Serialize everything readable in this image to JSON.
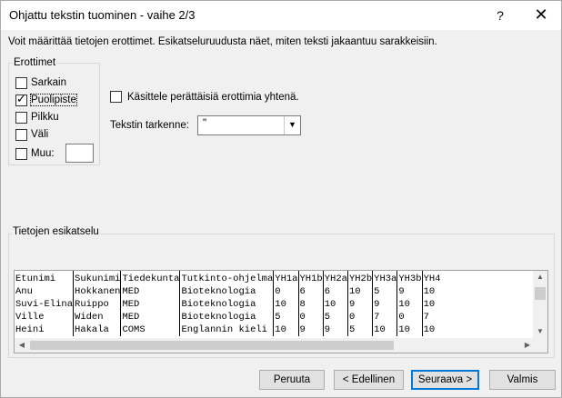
{
  "window": {
    "title": "Ohjattu tekstin tuominen - vaihe 2/3",
    "help": "?",
    "close": "✕"
  },
  "intro": "Voit määrittää tietojen erottimet. Esikatseluruudusta näet, miten teksti jakaantuu sarakkeisiin.",
  "delimiters": {
    "legend": "Erottimet",
    "items": [
      {
        "label": "Sarkain",
        "checked": false
      },
      {
        "label": "Puolipiste",
        "checked": true
      },
      {
        "label": "Pilkku",
        "checked": false
      },
      {
        "label": "Väli",
        "checked": false
      },
      {
        "label": "Muu:",
        "checked": false
      }
    ],
    "other_value": ""
  },
  "consecutive": {
    "label": "Käsittele perättäisiä erottimia yhtenä.",
    "checked": false
  },
  "text_qualifier": {
    "label": "Tekstin tarkenne:",
    "value": "\""
  },
  "preview": {
    "legend": "Tietojen esikatselu",
    "header": [
      "Etunimi",
      "Sukunimi",
      "Tiedekunta",
      "Tutkinto-ohjelma",
      "YH1a",
      "YH1b",
      "YH2a",
      "YH2b",
      "YH3a",
      "YH3b",
      "YH4"
    ],
    "rows": [
      [
        "Anu",
        "Hokkanen",
        "MED",
        "Bioteknologia",
        "0",
        "6",
        "6",
        "10",
        "5",
        "9",
        "10"
      ],
      [
        "Suvi-Elina",
        "Ruippo",
        "MED",
        "Bioteknologia",
        "10",
        "8",
        "10",
        "9",
        "9",
        "10",
        "10"
      ],
      [
        "Ville",
        "Widen",
        "MED",
        "Bioteknologia",
        "5",
        "0",
        "5",
        "0",
        "7",
        "0",
        "7"
      ],
      [
        "Heini",
        "Hakala",
        "COMS",
        "Englannin kieli",
        "10",
        "9",
        "9",
        "5",
        "10",
        "10",
        "10"
      ]
    ]
  },
  "buttons": {
    "cancel": "Peruuta",
    "back": "< Edellinen",
    "next": "Seuraava >",
    "finish": "Valmis"
  },
  "colors": {
    "focus": "#0078d7",
    "button_face": "#e1e1e1"
  }
}
